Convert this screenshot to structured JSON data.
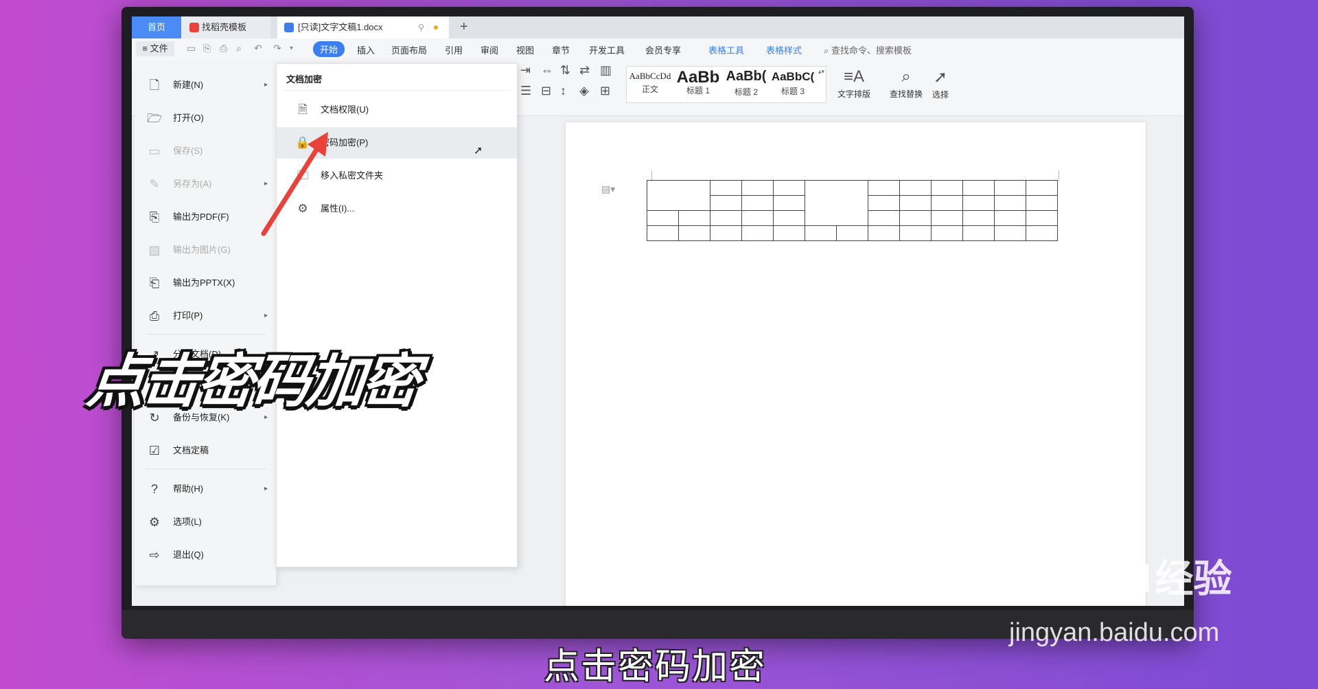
{
  "tabs": {
    "home": "首页",
    "template": "找稻壳模板",
    "document": "[只读]文字文稿1.docx",
    "new_tab": "+"
  },
  "menubar": {
    "file": "文件",
    "tabs": [
      "开始",
      "插入",
      "页面布局",
      "引用",
      "审阅",
      "视图",
      "章节",
      "开发工具",
      "会员专享"
    ],
    "context_tabs": [
      "表格工具",
      "表格样式"
    ],
    "search_placeholder": "查找命令、搜索模板"
  },
  "ribbon": {
    "styles": [
      {
        "preview": "AaBbCcDd",
        "name": "正文"
      },
      {
        "preview": "AaBb",
        "name": "标题 1"
      },
      {
        "preview": "AaBb(",
        "name": "标题 2"
      },
      {
        "preview": "AaBbC(",
        "name": "标题 3"
      }
    ],
    "text_layout": "文字排版",
    "find_replace": "查找替换",
    "select": "选择"
  },
  "file_menu": {
    "items": [
      {
        "label": "新建(N)",
        "icon": "new-doc-icon",
        "arrow": true,
        "disabled": false
      },
      {
        "label": "打开(O)",
        "icon": "folder-icon",
        "arrow": false,
        "disabled": false
      },
      {
        "label": "保存(S)",
        "icon": "save-icon",
        "arrow": false,
        "disabled": true
      },
      {
        "label": "另存为(A)",
        "icon": "save-as-icon",
        "arrow": true,
        "disabled": true
      },
      {
        "label": "输出为PDF(F)",
        "icon": "pdf-icon",
        "arrow": false,
        "disabled": false
      },
      {
        "label": "输出为图片(G)",
        "icon": "image-icon",
        "arrow": false,
        "disabled": true
      },
      {
        "label": "输出为PPTX(X)",
        "icon": "pptx-icon",
        "arrow": false,
        "disabled": false
      },
      {
        "label": "打印(P)",
        "icon": "print-icon",
        "arrow": true,
        "disabled": false
      },
      {
        "label": "分享文档(D)",
        "icon": "share-icon",
        "arrow": false,
        "disabled": false
      },
      {
        "label": "备份与恢复(K)",
        "icon": "backup-icon",
        "arrow": true,
        "disabled": false
      },
      {
        "label": "文档定稿",
        "icon": "finalize-icon",
        "arrow": false,
        "disabled": false
      },
      {
        "label": "帮助(H)",
        "icon": "help-icon",
        "arrow": true,
        "disabled": false
      },
      {
        "label": "选项(L)",
        "icon": "gear-icon",
        "arrow": false,
        "disabled": false
      },
      {
        "label": "退出(Q)",
        "icon": "exit-icon",
        "arrow": false,
        "disabled": false
      }
    ]
  },
  "submenu": {
    "title": "文档加密",
    "items": [
      {
        "label": "文档权限(U)",
        "icon": "doc-permission-icon",
        "highlighted": false
      },
      {
        "label": "密码加密(P)",
        "icon": "password-lock-icon",
        "highlighted": true
      },
      {
        "label": "移入私密文件夹",
        "icon": "private-folder-icon",
        "highlighted": false
      },
      {
        "label": "属性(I)...",
        "icon": "properties-icon",
        "highlighted": false
      }
    ]
  },
  "overlay": {
    "big_caption": "点击密码加密",
    "subtitle": "点击密码加密"
  },
  "watermark": {
    "brand": "Baidu",
    "brand_cn": "经验",
    "url": "jingyan.baidu.com"
  },
  "colors": {
    "accent": "#3b7ef2",
    "arrow": "#e8423a",
    "background_left": "#c14bcf",
    "background_right": "#7c4ad3"
  }
}
